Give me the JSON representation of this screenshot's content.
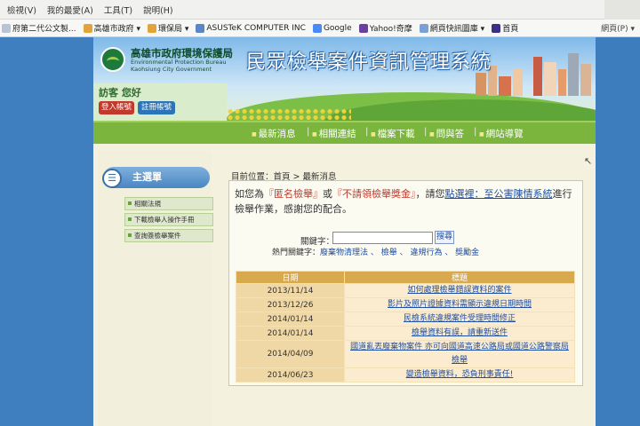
{
  "browser": {
    "menu": [
      "檢視(V)",
      "我的最愛(A)",
      "工具(T)",
      "說明(H)"
    ],
    "favorites": [
      {
        "label": "府第二代公文製...",
        "color": "#b8c4d6"
      },
      {
        "label": "高雄市政府 ▾",
        "color": "#e0a43a"
      },
      {
        "label": "環保局 ▾",
        "color": "#e0a43a"
      },
      {
        "label": "ASUSTeK COMPUTER INC",
        "color": "#5a86c7"
      },
      {
        "label": "Google",
        "color": "#4a8af4"
      },
      {
        "label": "Yahoo!奇摩",
        "color": "#6b3fa0"
      },
      {
        "label": "網頁快訊圖庫 ▾",
        "color": "#7aa1d6"
      },
      {
        "label": "首頁",
        "color": "#3b2f85"
      }
    ],
    "toolbar_right": [
      "網頁(P) ▾"
    ]
  },
  "header": {
    "org_name": "高雄市政府環境保護局",
    "org_en_line1": "Environmental Protection Bureau",
    "org_en_line2": "Kaohsiung City Government",
    "site_title": "民眾檢舉案件資訊管理系統"
  },
  "login": {
    "visitor": "訪客 您好",
    "login_label": "登入帳號",
    "register_label": "註冊帳號"
  },
  "nav": [
    "最新消息",
    "相關連結",
    "檔案下載",
    "問與答",
    "網站導覽"
  ],
  "sidebar": {
    "title": "主選單",
    "items": [
      "相關法規",
      "下載檢舉人操作手冊",
      "查詢簽檢舉案件"
    ]
  },
  "breadcrumb": "目前位置：首頁 > 最新消息",
  "notice": {
    "p1": "如您為",
    "q1": "『匿名檢舉』",
    "p2": "或",
    "q2": "『不請領檢舉獎金』",
    "p3": "，請您",
    "link": "點選裡：至公害陳情系統",
    "p4": "進行檢舉作業，感謝您的配合。"
  },
  "search": {
    "label": "關鍵字：",
    "value": "",
    "button": "搜尋",
    "hot_label": "熱門關鍵字：",
    "hot": "廢棄物清理法 、 檢舉 、 違規行為 、 獎勵金"
  },
  "news": {
    "col_date": "日期",
    "col_title": "標題",
    "rows": [
      {
        "date": "2013/11/14",
        "title": "如何處理檢舉錯誤資料的案件"
      },
      {
        "date": "2013/12/26",
        "title": "影片及照片證據資料需顯示違規日期時間"
      },
      {
        "date": "2014/01/14",
        "title": "民檢系統違規案件受理時間修正"
      },
      {
        "date": "2014/01/14",
        "title": "檢舉資料有誤，請重新送件"
      },
      {
        "date": "2014/04/09",
        "title": "國道亂丟廢棄物案件 亦可向國道高速公路局或國道公路警察局檢舉"
      },
      {
        "date": "2014/06/23",
        "title": "變造檢舉資料，恐負刑事責任!"
      }
    ]
  }
}
